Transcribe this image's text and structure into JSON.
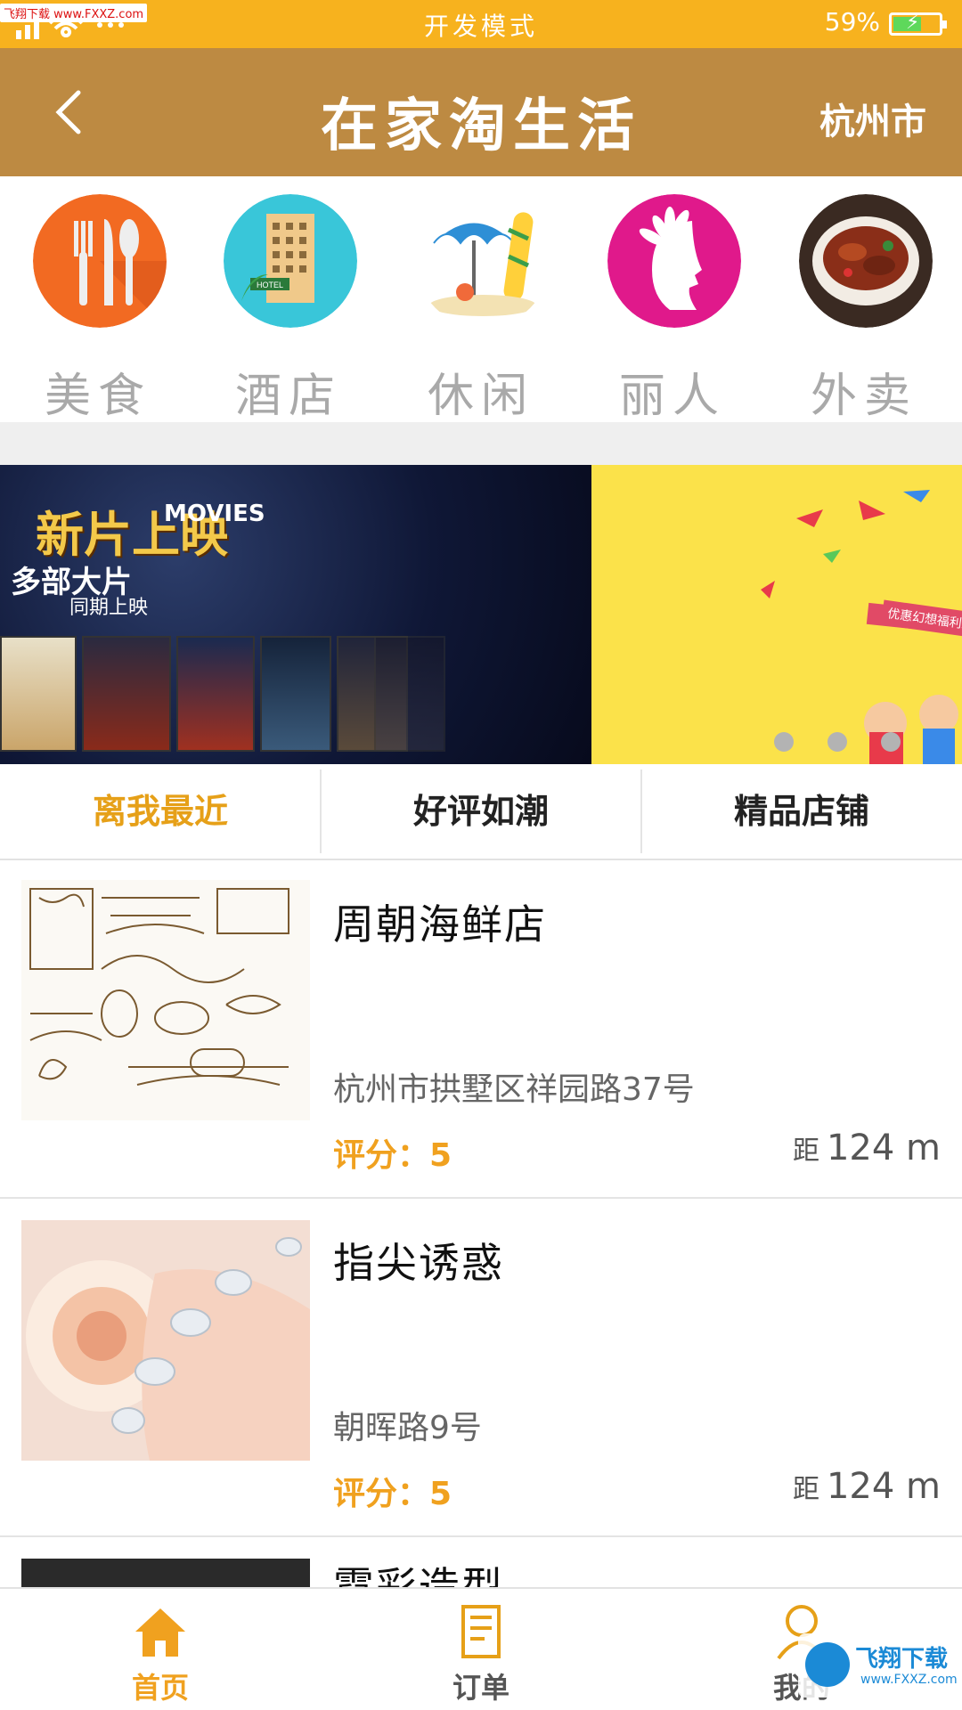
{
  "status_bar": {
    "watermark_tl": "飞翔下载 www.FXXZ.com",
    "mode": "开发模式",
    "battery": "59%",
    "battery_level": 0.59
  },
  "header": {
    "title": "在家淘生活",
    "city": "杭州市"
  },
  "categories": [
    {
      "label": "美食",
      "icon": "food-icon",
      "color": "#f26a22"
    },
    {
      "label": "酒店",
      "icon": "hotel-icon",
      "color": "#39c6d9"
    },
    {
      "label": "休闲",
      "icon": "leisure-icon",
      "color": "#ffffff"
    },
    {
      "label": "丽人",
      "icon": "beauty-icon",
      "color": "#e0198b"
    },
    {
      "label": "外卖",
      "icon": "takeout-icon",
      "color": "#3a2a22"
    }
  ],
  "banner": {
    "movies_tag": "MOVIES",
    "big_title": "新片上映",
    "subtitle": "多部大片",
    "sub2": "同期上映",
    "right_text": "优惠幻想福利来了",
    "dot_count": 3
  },
  "tabs": [
    "离我最近",
    "好评如潮",
    "精品店铺"
  ],
  "shops": [
    {
      "name": "周朝海鲜店",
      "address": "杭州市拱墅区祥园路37号",
      "rating": "评分：5",
      "distance_prefix": "距",
      "distance": "124 m"
    },
    {
      "name": "指尖诱惑",
      "address": "朝晖路9号",
      "rating": "评分：5",
      "distance_prefix": "距",
      "distance": "124 m"
    },
    {
      "name": "霓彩造型",
      "address": "",
      "rating": "",
      "distance_prefix": "",
      "distance": ""
    }
  ],
  "bottom_nav": [
    {
      "label": "首页",
      "icon": "home-icon",
      "active": true
    },
    {
      "label": "订单",
      "icon": "order-icon",
      "active": false
    },
    {
      "label": "我的",
      "icon": "user-icon",
      "active": false
    }
  ],
  "watermark_br": {
    "t1": "飞翔下载",
    "t2": "www.FXXZ.com"
  },
  "colors": {
    "accent": "#f7b21e",
    "header": "#bd8a42",
    "active_tab": "#e6a018",
    "rating": "#f0a11f"
  }
}
